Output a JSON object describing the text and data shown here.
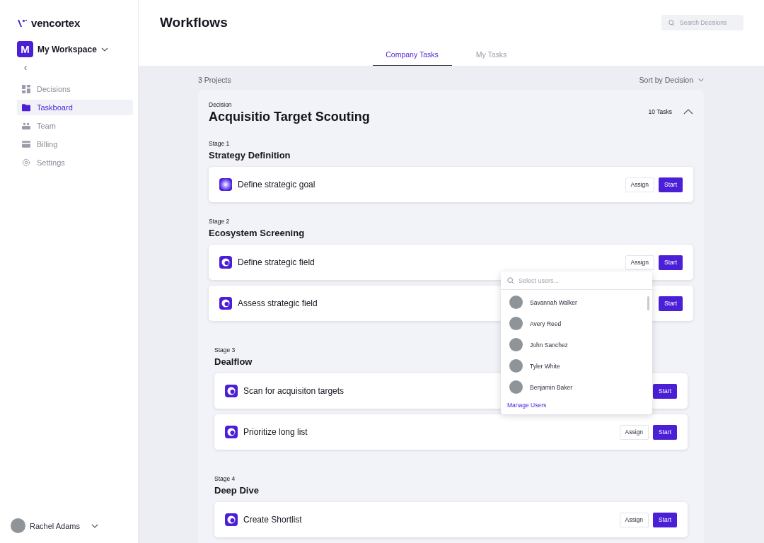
{
  "brand": {
    "name": "vencortex"
  },
  "workspace": {
    "initial": "M",
    "name": "My Workspace"
  },
  "sidebar": {
    "back": "‹",
    "items": [
      {
        "label": "Decisions",
        "kind": "grid",
        "selected": false
      },
      {
        "label": "Taskboard",
        "kind": "folder",
        "selected": true
      },
      {
        "label": "Team",
        "kind": "team",
        "selected": false
      },
      {
        "label": "Billing",
        "kind": "card",
        "selected": false
      },
      {
        "label": "Settings",
        "kind": "gear",
        "selected": false
      }
    ]
  },
  "user": {
    "name": "Rachel Adams"
  },
  "header": {
    "title": "Workflows",
    "search": {
      "placeholder": "Search Decisions"
    }
  },
  "tabs": [
    {
      "label": "Company Tasks",
      "selected": true
    },
    {
      "label": "My Tasks",
      "selected": false
    }
  ],
  "toolbar": {
    "count": "3 Projects",
    "sort": "Sort by Decision"
  },
  "decision": {
    "label": "Decision",
    "title": "Acquisitio Target Scouting",
    "tasks_count": "10 Tasks",
    "expanded": true,
    "stages": [
      {
        "label": "Stage 1",
        "title": "Strategy Definition",
        "indented": false,
        "tasks": [
          {
            "name": "Define strategic goal",
            "kind": "glow",
            "assign": "Assign",
            "start": "Start"
          }
        ]
      },
      {
        "label": "Stage 2",
        "title": "Ecosystem Screening",
        "indented": false,
        "tasks": [
          {
            "name": "Define strategic field",
            "kind": "ring",
            "assign": "Assign",
            "start": "Start",
            "assign_menu": {
              "placeholder": "Select users...",
              "users": [
                {
                  "name": "Savannah Walker"
                },
                {
                  "name": "Avery Reed"
                },
                {
                  "name": "John Sanchez"
                },
                {
                  "name": "Tyler White"
                },
                {
                  "name": "Benjamin Baker"
                }
              ],
              "link": "Manage Users"
            }
          },
          {
            "name": "Assess strategic field",
            "kind": "ring",
            "start": "Start"
          }
        ]
      },
      {
        "label": "Stage 3",
        "title": "Dealflow",
        "indented": true,
        "tasks": [
          {
            "name": "Scan for acquisiton targets",
            "kind": "ring",
            "start": "Start"
          },
          {
            "name": "Prioritize long list",
            "kind": "ring",
            "assign": "Assign",
            "start": "Start"
          }
        ]
      },
      {
        "label": "Stage 4",
        "title": "Deep Dive",
        "indented": true,
        "tasks": [
          {
            "name": "Create Shortlist",
            "kind": "ring",
            "assign": "Assign",
            "start": "Start"
          }
        ]
      }
    ]
  }
}
